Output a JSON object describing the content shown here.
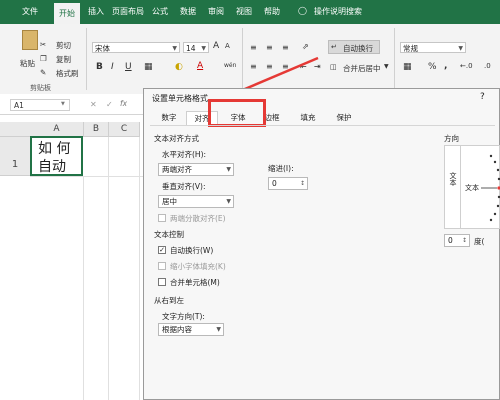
{
  "ribbon_tabs": {
    "file": "文件",
    "start": "开始",
    "insert": "插入",
    "layout": "页面布局",
    "formula": "公式",
    "data": "数据",
    "review": "审阅",
    "view": "视图",
    "help": "帮助",
    "search": "操作说明搜索"
  },
  "clipboard": {
    "paste": "粘贴",
    "cut": "剪切",
    "copy": "复制",
    "format_painter": "格式刷",
    "group_label": "剪贴板"
  },
  "font": {
    "name": "宋体",
    "size": "14",
    "bold": "B",
    "italic": "I",
    "underline": "U",
    "grow": "A",
    "shrink": "A",
    "font_color_letter": "A",
    "phonetic": "wén"
  },
  "alignment": {
    "wrap_text": "自动换行",
    "merge_center": "合并后居中"
  },
  "number": {
    "format": "常规",
    "percent": "%",
    "comma": ","
  },
  "name_box": {
    "value": "A1"
  },
  "sheet": {
    "columns": [
      "A",
      "B",
      "C"
    ],
    "row1": "1",
    "cell_a1_line1": "如 何",
    "cell_a1_line2": "自动"
  },
  "dialog": {
    "title": "设置单元格格式",
    "help": "?",
    "tabs": [
      "数字",
      "对齐",
      "字体",
      "边框",
      "填充",
      "保护"
    ],
    "text_align_section": "文本对齐方式",
    "h_align_label": "水平对齐(H):",
    "h_align_value": "两端对齐",
    "indent_label": "缩进(I):",
    "indent_value": "0",
    "v_align_label": "垂直对齐(V):",
    "v_align_value": "居中",
    "distributed_label": "两端分散对齐(E)",
    "text_control_section": "文本控制",
    "wrap_label": "自动换行(W)",
    "shrink_label": "缩小字体填充(K)",
    "merge_label": "合并单元格(M)",
    "rtl_section": "从右到左",
    "text_dir_label": "文字方向(T):",
    "text_dir_value": "根据内容",
    "orientation_label": "方向",
    "orientation_vertical_text": "文本",
    "orientation_text": "文本",
    "degree_value": "0",
    "degree_label": "度("
  },
  "colors": {
    "ribbon_green": "#217346",
    "highlight_red": "#e53935"
  }
}
